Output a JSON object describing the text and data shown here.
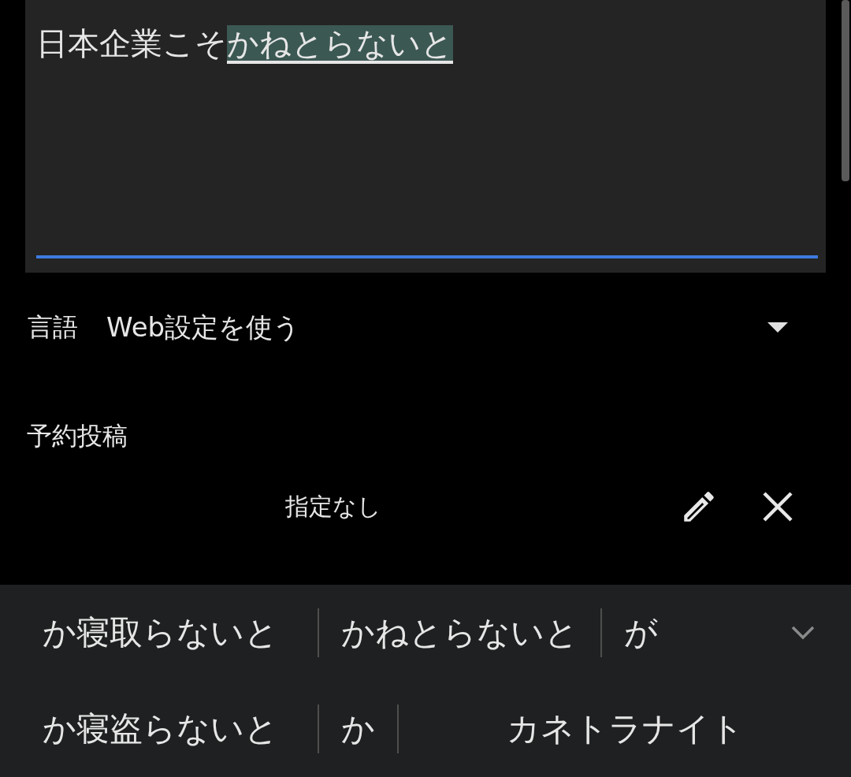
{
  "editor": {
    "text": "日本企業こそ",
    "composing": "かねとらないと"
  },
  "language": {
    "label": "言語",
    "value": "Web設定を使う"
  },
  "schedule": {
    "label": "予約投稿",
    "value": "指定なし"
  },
  "candidates": [
    [
      "か寝取らないと",
      "かねとらないと",
      "が"
    ],
    [
      "か寝盗らないと",
      "か",
      "カネトラナイト"
    ]
  ]
}
